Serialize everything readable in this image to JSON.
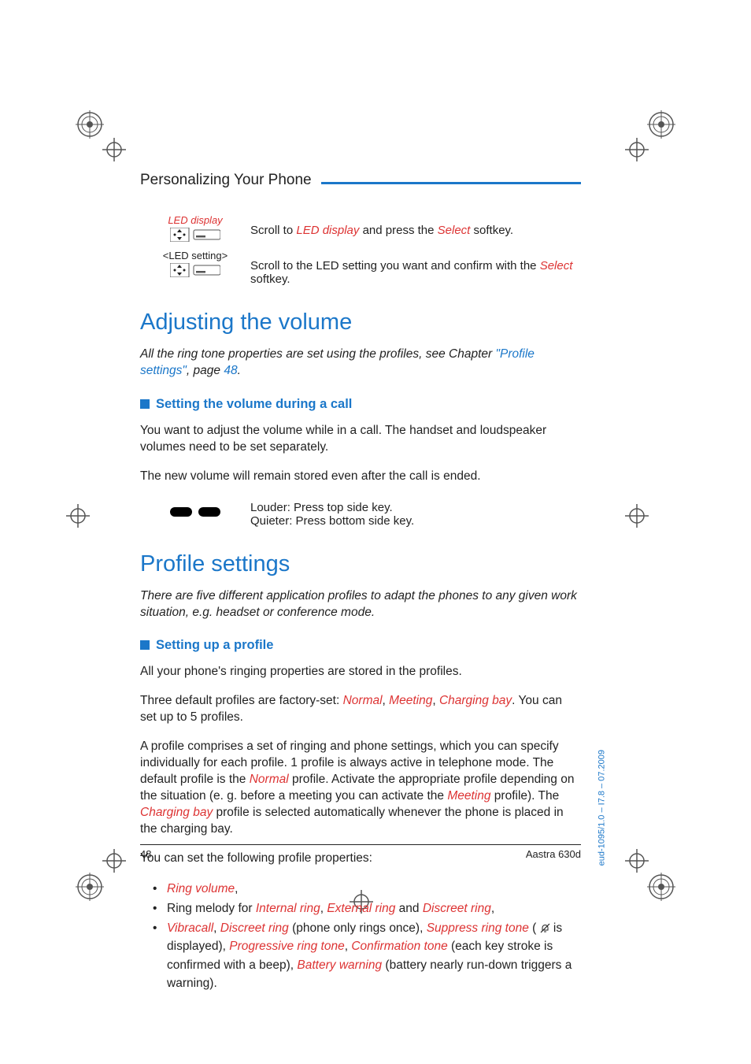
{
  "running_head": "Personalizing Your Phone",
  "steps": [
    {
      "caption_em": "LED display",
      "caption": "",
      "text_pre": "Scroll to ",
      "em1": "LED display",
      "mid": " and press the ",
      "em2": "Select",
      "post": " softkey."
    },
    {
      "caption_em": "",
      "caption": "<LED setting>",
      "text_pre": "Scroll to the LED setting you want and confirm with the ",
      "em1": "Select",
      "mid": "",
      "em2": "",
      "post": " softkey."
    }
  ],
  "section1": {
    "title": "Adjusting the volume",
    "intro_pre": "All the ring tone properties are set using the profiles, see Chapter ",
    "intro_link": "\"Profile settings\"",
    "intro_mid": ", page ",
    "intro_page": "48",
    "intro_post": ".",
    "sub_title": "Setting the volume during a call",
    "p1": "You want to adjust the volume while in a call. The handset and loudspeaker volumes need to be set separately.",
    "p2": "The new volume will remain stored even after the call is ended.",
    "step_louder": "Louder: Press top side key.",
    "step_quieter": "Quieter: Press bottom side key."
  },
  "section2": {
    "title": "Profile settings",
    "intro": "There are five different application profiles to adapt the phones to any given work situation, e.g. headset or conference mode.",
    "sub_title": "Setting up a profile",
    "p1": "All your phone's ringing properties are stored in the profiles.",
    "p2_pre": "Three default profiles are factory-set: ",
    "p2_e1": "Normal",
    "p2_s1": ", ",
    "p2_e2": "Meeting",
    "p2_s2": ", ",
    "p2_e3": "Charging bay",
    "p2_post": ". You can set up to 5 profiles.",
    "p3_pre": "A profile comprises a set of ringing and phone settings, which you can specify individually for each profile. 1 profile is always active in telephone mode. The default profile is the ",
    "p3_e1": "Normal",
    "p3_mid1": " profile. Activate the appropriate profile depending on the situation (e. g. before a meeting you can activate the ",
    "p3_e2": "Meeting",
    "p3_mid2": " profile). The ",
    "p3_e3": "Charging bay",
    "p3_post": " profile is selected automatically whenever the phone is placed in the charging bay.",
    "p4": "You can set the following profile properties:",
    "bullets": {
      "b1": {
        "e1": "Ring volume",
        "post": ","
      },
      "b2": {
        "pre": "Ring melody for ",
        "e1": "Internal ring",
        "s1": ", ",
        "e2": "External ring",
        "s2": " and ",
        "e3": "Discreet ring",
        "post": ","
      },
      "b3": {
        "e1": "Vibracall",
        "s1": ", ",
        "e2": "Discreet ring",
        "s2": " (phone only rings once), ",
        "e3": "Suppress ring tone",
        "s3": " ( ",
        "s3b": " is displayed), ",
        "e4": "Progressive ring tone",
        "s4": ", ",
        "e5": "Confirmation tone",
        "s5": " (each key stroke is confirmed with a beep), ",
        "e6": "Battery warning",
        "s6": " (battery nearly run-down triggers a warning)."
      }
    }
  },
  "footer": {
    "page": "48",
    "model": "Aastra 630d"
  },
  "side_note": "eud-1095/1.0 – I7.8 – 07.2009"
}
